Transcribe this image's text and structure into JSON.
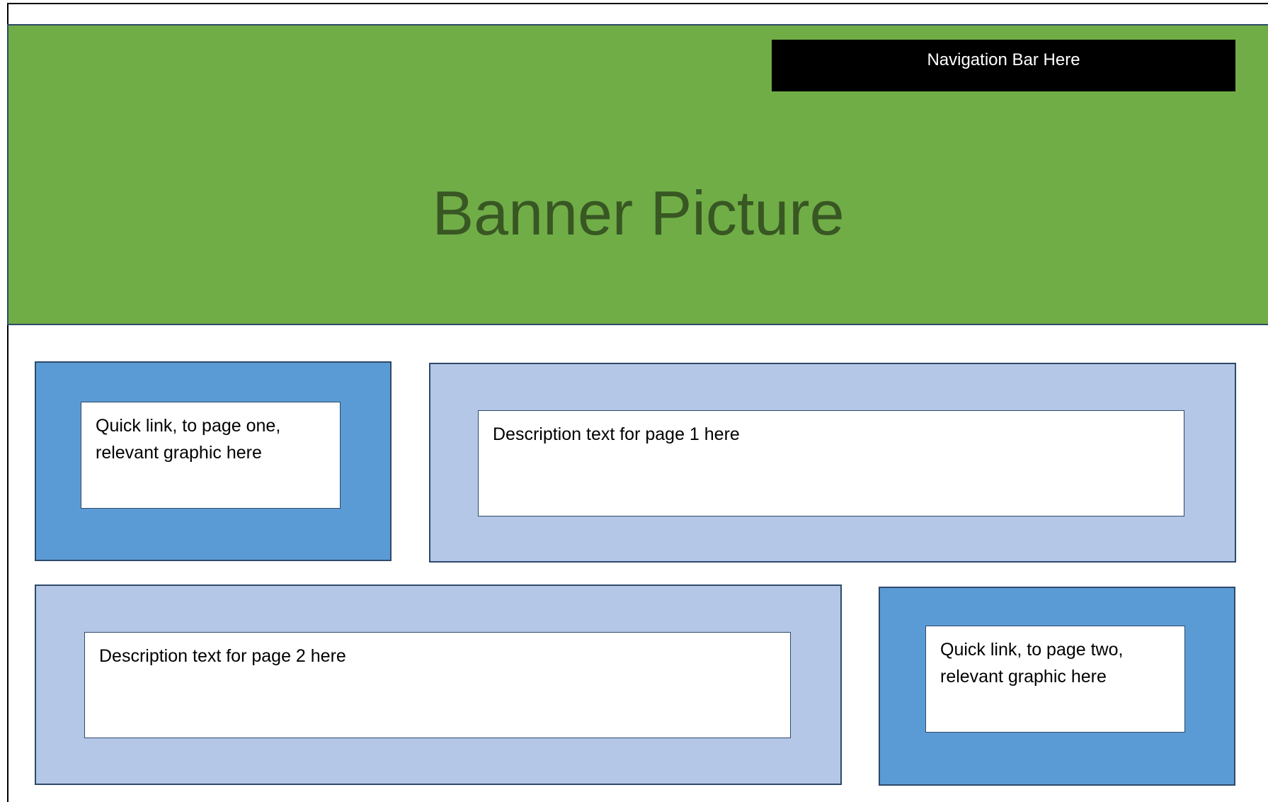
{
  "colors": {
    "banner_bg": "#70ad47",
    "banner_text": "#385723",
    "navbar_bg": "#000000",
    "navbar_text": "#ffffff",
    "quick_link_bg": "#5b9bd5",
    "description_bg": "#b4c7e7",
    "border": "#2e4a6b"
  },
  "banner": {
    "title": "Banner Picture"
  },
  "navbar": {
    "label": "Navigation Bar Here"
  },
  "quick_links": [
    {
      "text": "Quick link, to page one, relevant graphic here"
    },
    {
      "text": "Quick link, to page two, relevant graphic here"
    }
  ],
  "descriptions": [
    {
      "text": "Description text for page 1 here"
    },
    {
      "text": "Description text for page 2 here"
    }
  ]
}
